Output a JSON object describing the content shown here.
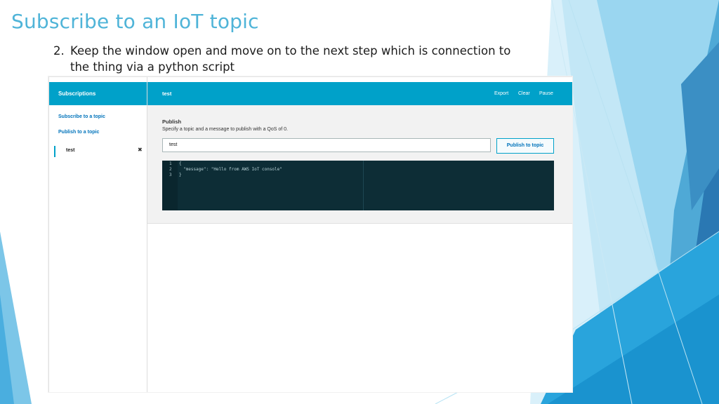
{
  "slide": {
    "title": "Subscribe to an IoT topic",
    "step_number": "2.",
    "step_line1": "Keep the window open and move on to the next step which is connection to",
    "step_line2": "the thing via a python script"
  },
  "sidebar": {
    "header": "Subscriptions",
    "subscribe_link": "Subscribe to a topic",
    "publish_link": "Publish to a topic",
    "subscription": {
      "topic": "test",
      "close_glyph": "✖"
    }
  },
  "main": {
    "header": {
      "topic": "test",
      "actions": {
        "export": "Export",
        "clear": "Clear",
        "pause": "Pause"
      }
    },
    "publish": {
      "title": "Publish",
      "description": "Specify a topic and a message to publish with a QoS of 0.",
      "topic_value": "test",
      "button_label": "Publish to topic",
      "editor": {
        "line_numbers": [
          "1",
          "2",
          "3"
        ],
        "lines": [
          "{",
          "\"message\": \"Hello from AWS IoT console\"",
          "}"
        ]
      }
    }
  },
  "colors": {
    "accent": "#00a1c9",
    "link": "#0073bb",
    "title": "#4fb4d8",
    "editor_bg": "#0d2d36"
  }
}
